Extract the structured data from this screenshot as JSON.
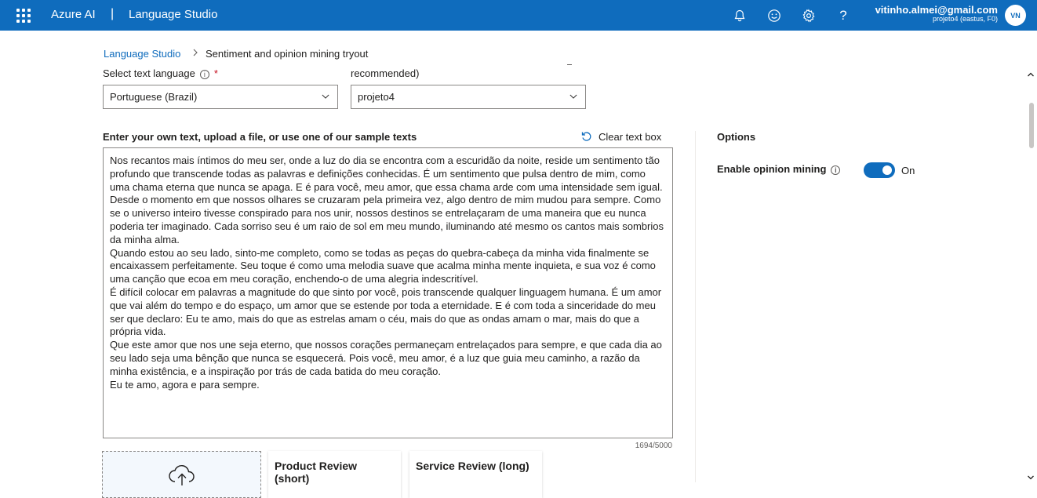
{
  "topbar": {
    "brand": "Azure AI",
    "separator": "|",
    "product": "Language Studio",
    "account_email": "vitinho.almei@gmail.com",
    "account_directory": "projeto4 (eastus, F0)",
    "avatar_initials": "VN",
    "icons": [
      "waffle-icon",
      "bell-icon",
      "smiley-icon",
      "gear-icon",
      "help-icon"
    ]
  },
  "breadcrumb": {
    "root": "Language Studio",
    "current": "Sentiment and opinion mining tryout"
  },
  "form": {
    "language_label": "Select text language",
    "language_required": "*",
    "language_value": "Portuguese (Brazil)",
    "resource_label": "recommended)",
    "resource_value": "projeto4"
  },
  "text_input": {
    "title": "Enter your own text, upload a file, or use one of our sample texts",
    "clear_label": "Clear text box",
    "content": "Nos recantos mais íntimos do meu ser, onde a luz do dia se encontra com a escuridão da noite, reside um sentimento tão profundo que transcende todas as palavras e definições conhecidas. É um sentimento que pulsa dentro de mim, como uma chama eterna que nunca se apaga. E é para você, meu amor, que essa chama arde com uma intensidade sem igual.\nDesde o momento em que nossos olhares se cruzaram pela primeira vez, algo dentro de mim mudou para sempre. Como se o universo inteiro tivesse conspirado para nos unir, nossos destinos se entrelaçaram de uma maneira que eu nunca poderia ter imaginado. Cada sorriso seu é um raio de sol em meu mundo, iluminando até mesmo os cantos mais sombrios da minha alma.\nQuando estou ao seu lado, sinto-me completo, como se todas as peças do quebra-cabeça da minha vida finalmente se encaixassem perfeitamente. Seu toque é como uma melodia suave que acalma minha mente inquieta, e sua voz é como uma canção que ecoa em meu coração, enchendo-o de uma alegria indescritível.\nÉ difícil colocar em palavras a magnitude do que sinto por você, pois transcende qualquer linguagem humana. É um amor que vai além do tempo e do espaço, um amor que se estende por toda a eternidade. E é com toda a sinceridade do meu ser que declaro: Eu te amo, mais do que as estrelas amam o céu, mais do que as ondas amam o mar, mais do que a própria vida.\nQue este amor que nos une seja eterno, que nossos corações permaneçam entrelaçados para sempre, e que cada dia ao seu lado seja uma bênção que nunca se esquecerá. Pois você, meu amor, é a luz que guia meu caminho, a razão da minha existência, e a inspiração por trás de cada batida do meu coração.\nEu te amo, agora e para sempre.",
    "char_count": "1694/5000"
  },
  "samples": {
    "upload_icon": "cloud-upload-icon",
    "card1": "Product Review (short)",
    "card2": "Service Review (long)"
  },
  "options": {
    "title": "Options",
    "opinion_label": "Enable opinion mining",
    "toggle_state": "On",
    "toggle_on": true
  },
  "colors": {
    "brand_blue": "#0f6cbd",
    "required_red": "#c50f1f"
  }
}
